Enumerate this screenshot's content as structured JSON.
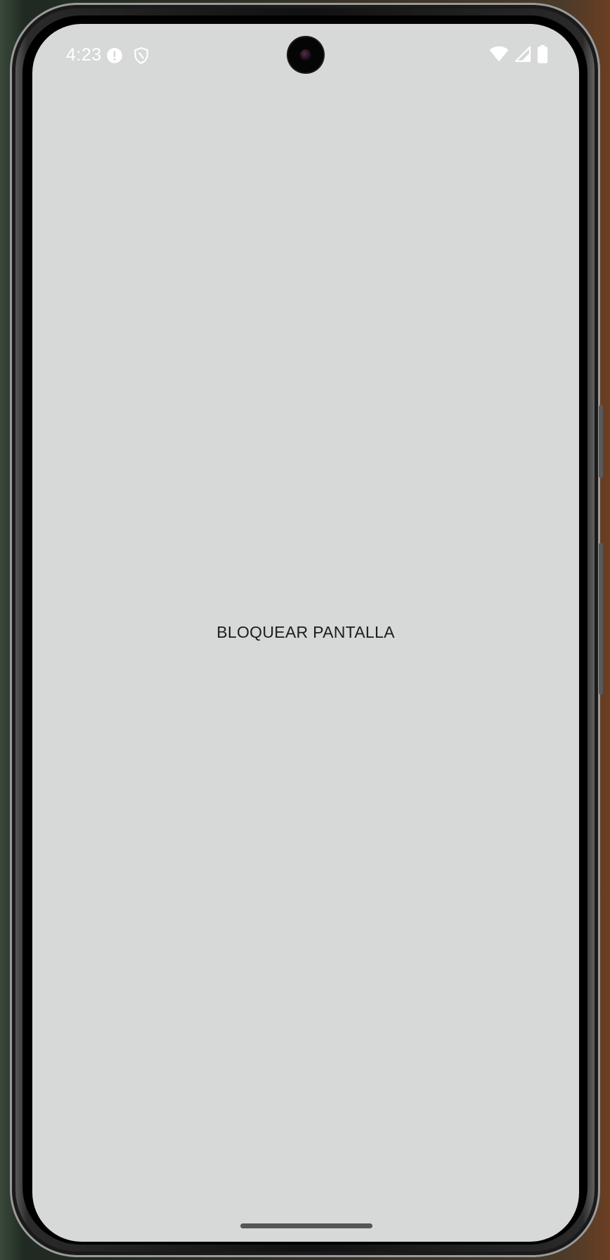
{
  "status_bar": {
    "time": "4:23",
    "left_icons": [
      "alert-circle-icon",
      "shield-icon"
    ],
    "right_icons": [
      "wifi-icon",
      "cell-signal-icon",
      "battery-icon"
    ]
  },
  "screen": {
    "center_label": "BLOQUEAR PANTALLA",
    "background_color": "#d7d8d8",
    "text_color": "#1c1c1c"
  }
}
